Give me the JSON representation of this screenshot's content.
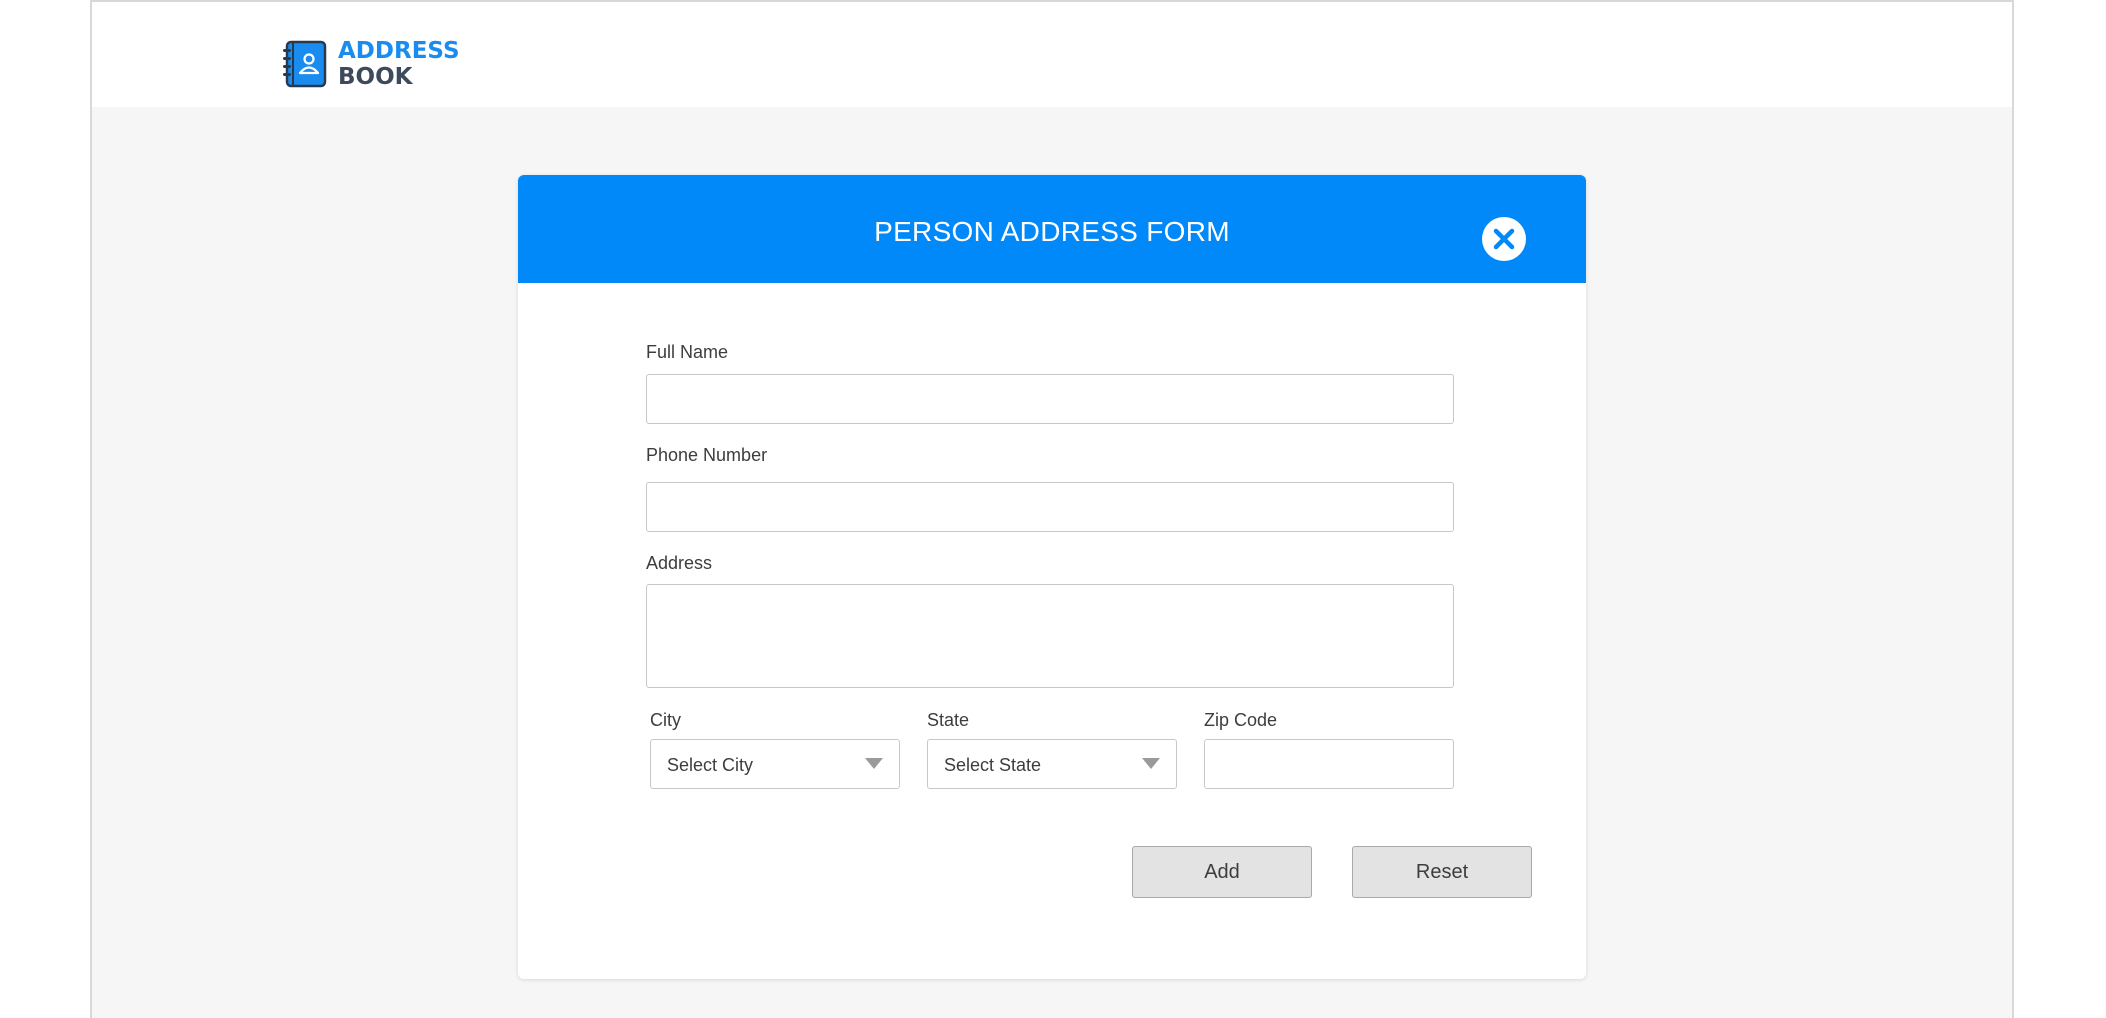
{
  "header": {
    "logo_line1": "ADDRESS",
    "logo_line2": "BOOK",
    "logo_icon": "address-book-icon"
  },
  "form": {
    "title": "PERSON ADDRESS FORM",
    "close_icon": "close-icon",
    "full_name": {
      "label": "Full Name",
      "value": ""
    },
    "phone": {
      "label": "Phone Number",
      "value": ""
    },
    "address": {
      "label": "Address",
      "value": ""
    },
    "city": {
      "label": "City",
      "selected": "Select City"
    },
    "state": {
      "label": "State",
      "selected": "Select State"
    },
    "zip": {
      "label": "Zip Code",
      "value": ""
    },
    "add_label": "Add",
    "reset_label": "Reset"
  },
  "colors": {
    "accent": "#0189f9",
    "logo_blue": "#1a8cf0",
    "logo_dark": "#3c4a5c",
    "background": "#f6f6f6"
  }
}
